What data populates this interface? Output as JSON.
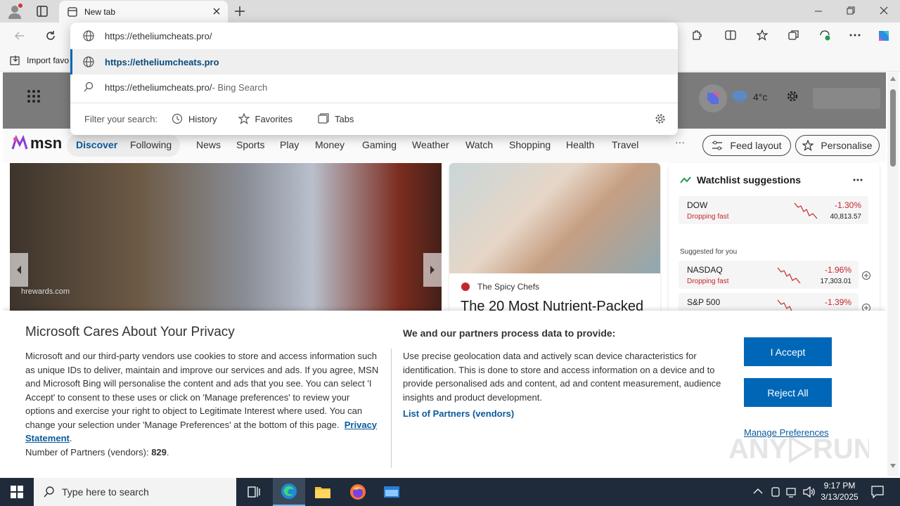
{
  "browser": {
    "tab_title": "New tab",
    "address_value": "https://etheliumcheats.pro/",
    "favbar_import": "Import favo"
  },
  "dropdown": {
    "suggestion_url": "https://etheliumcheats.pro",
    "search_query": "https://etheliumcheats.pro/",
    "search_suffix": " - Bing Search",
    "filter_label": "Filter your search:",
    "filters": [
      "History",
      "Favorites",
      "Tabs"
    ]
  },
  "msn": {
    "logo": "msn",
    "temperature": "4°c",
    "nav": [
      "Discover",
      "Following",
      "News",
      "Sports",
      "Play",
      "Money",
      "Gaming",
      "Weather",
      "Watch",
      "Shopping",
      "Health",
      "Travel"
    ],
    "more": "···",
    "feed_layout": "Feed layout",
    "personalise": "Personalise",
    "hero_source": "hrewards.com",
    "card_source": "The Spicy Chefs",
    "card_title": "The 20 Most Nutrient-Packed"
  },
  "watchlist": {
    "title": "Watchlist suggestions",
    "suggested_label": "Suggested for you",
    "stocks": [
      {
        "name": "DOW",
        "status": "Dropping fast",
        "change": "-1.30%",
        "value": "40,813.57"
      },
      {
        "name": "NASDAQ",
        "status": "Dropping fast",
        "change": "-1.96%",
        "value": "17,303.01"
      },
      {
        "name": "S&P 500",
        "status": "",
        "change": "-1.39%",
        "value": ""
      }
    ]
  },
  "privacy": {
    "title": "Microsoft Cares About Your Privacy",
    "body": "Microsoft and our third-party vendors use cookies to store and access information such as unique IDs to deliver, maintain and improve our services and ads. If you agree, MSN and Microsoft Bing will personalise the content and ads that you see. You can select 'I Accept' to consent to these uses or click on 'Manage preferences' to review your options and exercise your right to object to Legitimate Interest where used.  You can change your selection under 'Manage Preferences' at the bottom of this page.",
    "privacy_link": "Privacy Statement",
    "partners_label": "Number of Partners (vendors): ",
    "partners_count": "829",
    "right_title": "We and our partners process data to provide:",
    "right_body": "Use precise geolocation data and actively scan device characteristics for identification. This is done to store and access information on a device and to provide personalised ads and content, ad and content measurement, audience insights and product development.",
    "partners_link": "List of Partners (vendors)",
    "accept": "I Accept",
    "reject": "Reject All",
    "manage": "Manage Preferences"
  },
  "taskbar": {
    "search_placeholder": "Type here to search",
    "time": "9:17 PM",
    "date": "3/13/2025"
  },
  "colors": {
    "accent": "#0067b8",
    "link": "#0a5a9c",
    "taskbar": "#1f2b3a",
    "red": "#c4262e"
  }
}
